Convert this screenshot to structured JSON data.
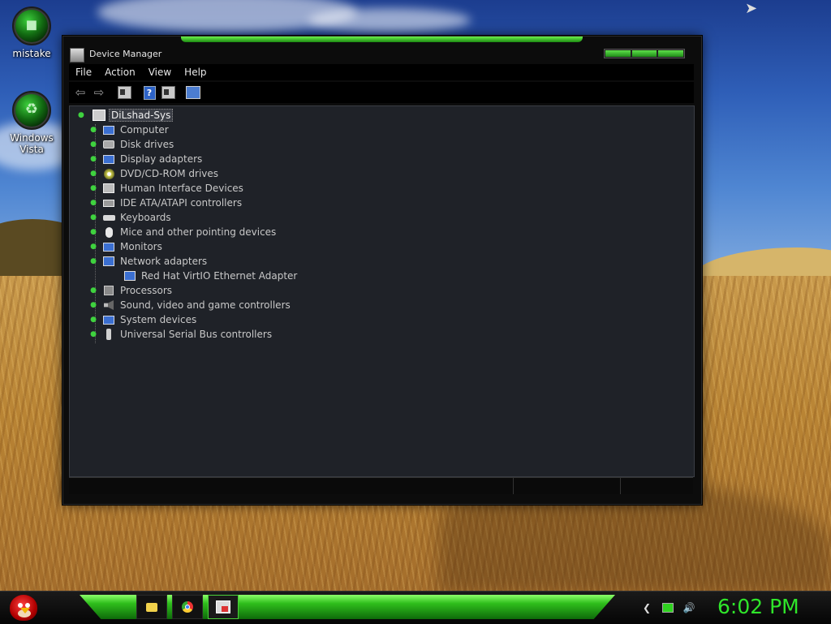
{
  "desktop": {
    "icons": [
      {
        "label": "mistake"
      },
      {
        "label": "Windows Vista"
      }
    ]
  },
  "window": {
    "title": "Device Manager",
    "menu": [
      "File",
      "Action",
      "View",
      "Help"
    ],
    "tree": {
      "root": "DiLshad-Sys",
      "categories": [
        {
          "label": "Computer",
          "icon": "computer-icon"
        },
        {
          "label": "Disk drives",
          "icon": "disk-drive-icon"
        },
        {
          "label": "Display adapters",
          "icon": "display-adapter-icon"
        },
        {
          "label": "DVD/CD-ROM drives",
          "icon": "dvd-drive-icon"
        },
        {
          "label": "Human Interface Devices",
          "icon": "hid-icon"
        },
        {
          "label": "IDE ATA/ATAPI controllers",
          "icon": "ide-controller-icon"
        },
        {
          "label": "Keyboards",
          "icon": "keyboard-icon"
        },
        {
          "label": "Mice and other pointing devices",
          "icon": "mouse-icon"
        },
        {
          "label": "Monitors",
          "icon": "monitor-icon"
        },
        {
          "label": "Network adapters",
          "icon": "network-adapter-icon",
          "expanded": true,
          "children": [
            {
              "label": "Red Hat VirtIO Ethernet Adapter",
              "icon": "ethernet-adapter-icon"
            }
          ]
        },
        {
          "label": "Processors",
          "icon": "processor-icon"
        },
        {
          "label": "Sound, video and game controllers",
          "icon": "sound-icon"
        },
        {
          "label": "System devices",
          "icon": "system-devices-icon"
        },
        {
          "label": "Universal Serial Bus controllers",
          "icon": "usb-icon"
        }
      ]
    }
  },
  "taskbar": {
    "clock": "6:02 PM",
    "buttons": [
      "folder-icon",
      "chrome-icon",
      "device-manager-icon"
    ],
    "tray": [
      "collapse-icon",
      "network-icon",
      "volume-icon"
    ]
  },
  "colors": {
    "accent": "#2fe62a",
    "content_bg": "#1f2228",
    "text": "#c8c8c8"
  }
}
